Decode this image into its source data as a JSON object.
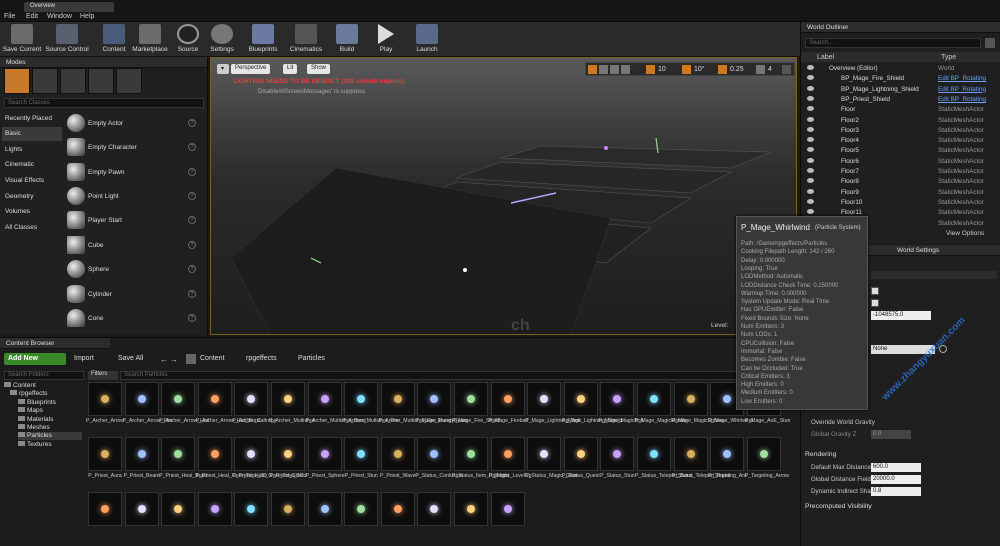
{
  "menu": {
    "items": [
      "File",
      "Edit",
      "Window",
      "Help"
    ],
    "tab": "Overview"
  },
  "toolbar": {
    "buttons": [
      "Save Current",
      "Source Control",
      "Content",
      "Marketplace",
      "Source",
      "Settings",
      "Blueprints",
      "Cinematics",
      "Build",
      "Play",
      "Launch"
    ]
  },
  "modes": {
    "tab": "Modes",
    "search_placeholder": "Search Classes",
    "categories": [
      "Recently Placed",
      "Basic",
      "Lights",
      "Cinematic",
      "Visual Effects",
      "Geometry",
      "Volumes",
      "All Classes"
    ],
    "items": [
      "Empty Actor",
      "Empty Character",
      "Empty Pawn",
      "Point Light",
      "Player Start",
      "Cube",
      "Sphere",
      "Cylinder",
      "Cone"
    ]
  },
  "viewport": {
    "perspective": "Perspective",
    "lit": "Lit",
    "show": "Show",
    "warning": "LIGHTING NEEDS TO BE REBUILT (229 unbuilt objects)",
    "suppress": "'DisableAllScreenMessages' to suppress",
    "grid": "10",
    "angle": "10°",
    "scale": "0.25",
    "cams": "4",
    "level": "Level: "
  },
  "outliner": {
    "tab": "World Outliner",
    "search_placeholder": "Search...",
    "col_label": "Label",
    "col_type": "Type",
    "rows": [
      {
        "label": "Overview (Editor)",
        "type": "World",
        "link": false
      },
      {
        "label": "BP_Mage_Fire_Shield",
        "type": "Edit BP_Rotating",
        "link": true
      },
      {
        "label": "BP_Mage_Lightning_Shield",
        "type": "Edit BP_Rotating",
        "link": true
      },
      {
        "label": "BP_Priest_Shield",
        "type": "Edit BP_Rotating",
        "link": true
      },
      {
        "label": "Floor",
        "type": "StaticMeshActor",
        "link": false
      },
      {
        "label": "Floor2",
        "type": "StaticMeshActor",
        "link": false
      },
      {
        "label": "Floor3",
        "type": "StaticMeshActor",
        "link": false
      },
      {
        "label": "Floor4",
        "type": "StaticMeshActor",
        "link": false
      },
      {
        "label": "Floor5",
        "type": "StaticMeshActor",
        "link": false
      },
      {
        "label": "Floor6",
        "type": "StaticMeshActor",
        "link": false
      },
      {
        "label": "Floor7",
        "type": "StaticMeshActor",
        "link": false
      },
      {
        "label": "Floor8",
        "type": "StaticMeshActor",
        "link": false
      },
      {
        "label": "Floor9",
        "type": "StaticMeshActor",
        "link": false
      },
      {
        "label": "Floor10",
        "type": "StaticMeshActor",
        "link": false
      },
      {
        "label": "Floor11",
        "type": "StaticMeshActor",
        "link": false
      },
      {
        "label": "Floor12",
        "type": "StaticMeshActor",
        "link": false
      }
    ],
    "view_options": "View Options"
  },
  "tooltip": {
    "title": "P_Mage_Whirlwind",
    "subtitle": "(Particle System)",
    "lines": [
      "Path: /Game/rpgeffects/Particles",
      "Cooking Filepath Length: 142 / 260",
      "Delay: 0.000000",
      "Looping: True",
      "LODMethod: Automatic",
      "LODDistance Check Time: 0.250000",
      "Warmup Time: 0.000000",
      "System Update Mode: Real Time",
      "Has GPUEmitter: False",
      "Fixed Bounds Size: None",
      "Num Emitters: 3",
      "Num LODs: 1",
      "CPUCollision: False",
      "Immortal: False",
      "Becomes Zombie: False",
      "Can be Occluded: True",
      "Critical Emitters: 3",
      "High Emitters: 0",
      "Medium Emitters: 0",
      "Low Emitters: 0"
    ]
  },
  "details": {
    "tab": "World Settings",
    "value1": "-1048575.0",
    "none": "None",
    "override": "Override World Gravity",
    "gravity": "Global Gravity Z",
    "gravity_val": "0.0",
    "rendering": "Rendering",
    "r1": "Default Max Distance",
    "r1v": "600.0",
    "r2": "Global Distance Field V",
    "r2v": "20000.0",
    "r3": "Dynamic Indirect Shac",
    "r3v": "0.8",
    "precomputed": "Precomputed Visibility"
  },
  "content_browser": {
    "tab": "Content Browser",
    "add_new": "Add New",
    "import": "Import",
    "save_all": "Save All",
    "crumbs": [
      "Content",
      "rpgeffects",
      "Particles"
    ],
    "search_folders": "Search Folders",
    "filters": "Filters",
    "search_particles": "Search Particles",
    "tree": [
      "Content",
      "rpgeffects",
      "Blueprints",
      "Maps",
      "Materials",
      "Meshes",
      "Particles",
      "Textures"
    ],
    "assets_row1": [
      "P_Archer_Arrow",
      "P_Archer_Arrow_Fire",
      "P_Archer_Arrow_Hail",
      "P_Archer_Arrow_Hail_Burst",
      "P_Archer_Caltrops",
      "P_Archer_Multishot",
      "P_Archer_Multishot_Burst",
      "P_Archer_Multishot_Fire",
      "P_Archer_Multishot_Fire_Burst",
      "P_Mage_EnergyBeam",
      "P_Mage_Fire_Shield",
      "P_Mage_Fireball",
      "P_Mage_Lightning_Bolt",
      "P_Mage_Lightning_Shield",
      "P_Mage_MagicBolt",
      "P_Mage_MagicMissile",
      "P_Mage_MagicSphere",
      "P_Mage_Whirlwind",
      "P_Mage_AoE_Stun"
    ],
    "assets_row2": [
      "P_Priest_Aura",
      "P_Priest_Beam",
      "P_Priest_Heal_Burst",
      "P_Priest_Heal_Over_Time_3D",
      "P_Priest_Heal_Over_Time_3D",
      "P_Priest_Shield",
      "P_Priest_Sphere",
      "P_Priest_Stun",
      "P_Priest_Wave",
      "P_Status_Confusion",
      "P_Status_Item_Highlight",
      "P_Status_LevelUp",
      "P_Status_Magic_Glow",
      "P_Status_Quest",
      "P_Status_Stun",
      "P_Status_Teleport_Burst",
      "P_Status_Teleport_Portal",
      "P_Targeting_Arc",
      "P_Targeting_Arrow"
    ]
  },
  "watermark": "www.zhangyuxuan.com"
}
